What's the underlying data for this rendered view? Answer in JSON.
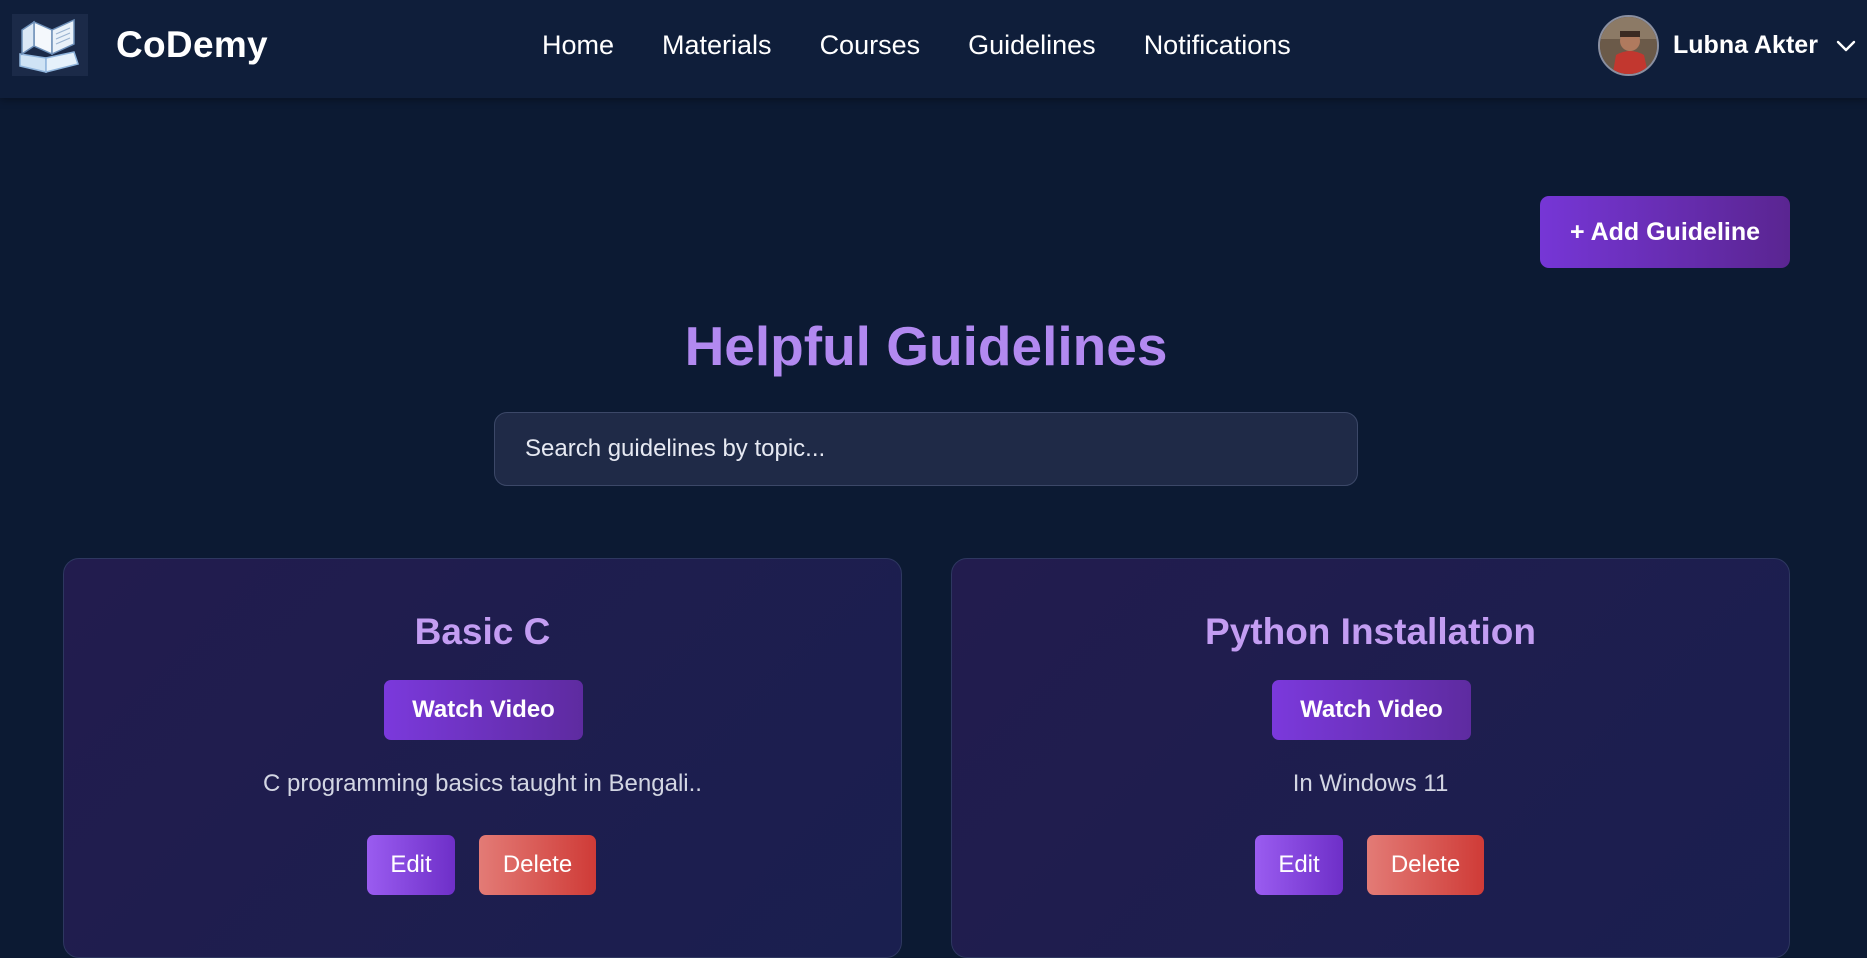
{
  "brand": {
    "name": "CoDemy",
    "logo_icon": "book-laptop-logo-icon"
  },
  "nav": {
    "links": [
      "Home",
      "Materials",
      "Courses",
      "Guidelines",
      "Notifications"
    ]
  },
  "user": {
    "name": "Lubna Akter",
    "avatar_icon": "user-avatar",
    "menu_icon": "chevron-down-icon"
  },
  "actions": {
    "add_guideline_label": "+ Add Guideline"
  },
  "page": {
    "title": "Helpful Guidelines"
  },
  "search": {
    "placeholder": "Search guidelines by topic..."
  },
  "guidelines": [
    {
      "title": "Basic C",
      "watch_label": "Watch Video",
      "description": "C programming basics taught in Bengali..",
      "edit_label": "Edit",
      "delete_label": "Delete"
    },
    {
      "title": "Python Installation",
      "watch_label": "Watch Video",
      "description": "In Windows 11",
      "edit_label": "Edit",
      "delete_label": "Delete"
    }
  ],
  "colors": {
    "background": "#0c1a33",
    "navbar": "#0f1e3a",
    "accent_purple": "#7636d6",
    "title_purple": "#b289f0",
    "delete_red": "#cf3b37"
  }
}
